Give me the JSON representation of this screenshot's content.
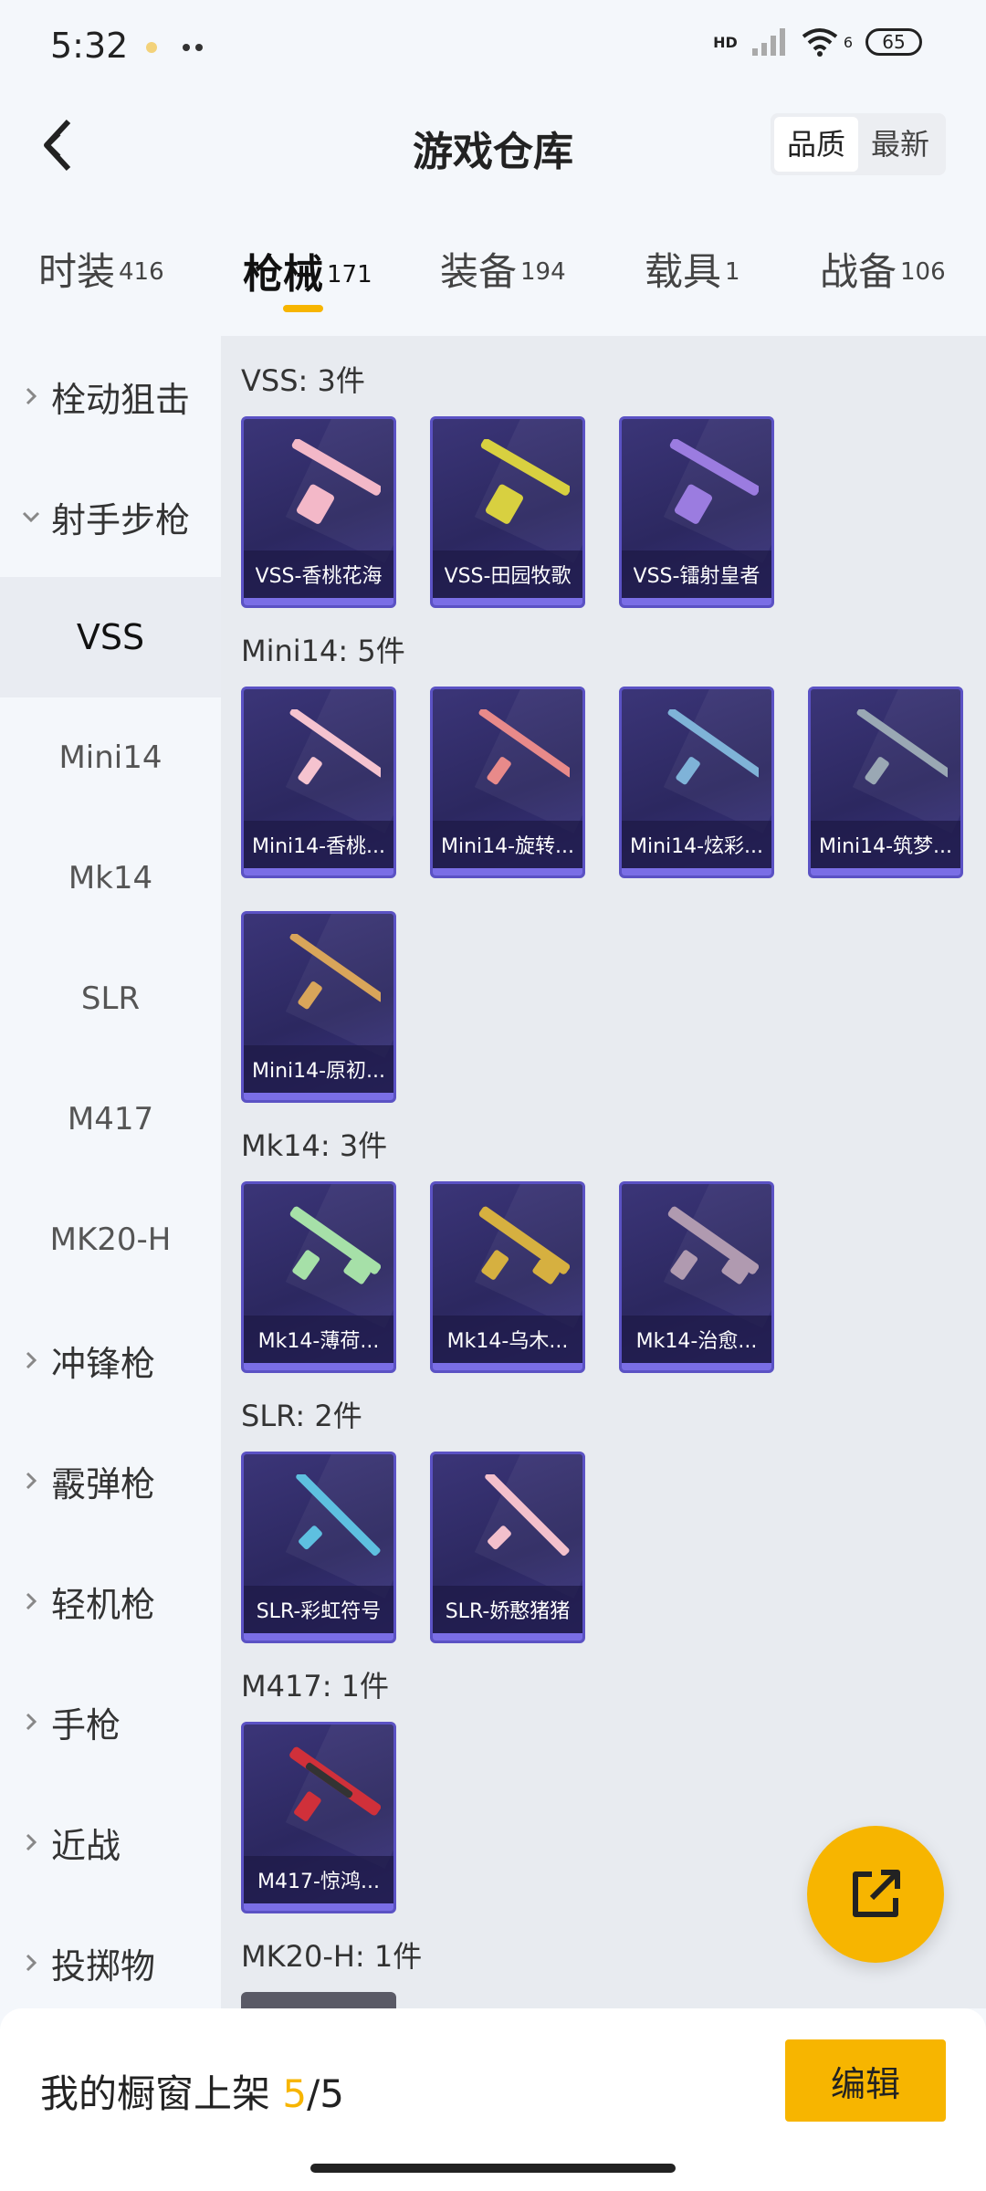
{
  "status_bar": {
    "time": "5:32",
    "battery": "65",
    "network": "HD",
    "signal_small": "6"
  },
  "header": {
    "title": "游戏仓库",
    "sort_options": [
      {
        "label": "品质",
        "active": true
      },
      {
        "label": "最新",
        "active": false
      }
    ]
  },
  "tabs": [
    {
      "label": "时装",
      "count": "416"
    },
    {
      "label": "枪械",
      "count": "171",
      "active": true
    },
    {
      "label": "装备",
      "count": "194"
    },
    {
      "label": "载具",
      "count": "1"
    },
    {
      "label": "战备",
      "count": "106"
    }
  ],
  "sidebar": {
    "items": [
      {
        "label": "栓动狙击",
        "type": "category",
        "expanded": false
      },
      {
        "label": "射手步枪",
        "type": "category",
        "expanded": true
      },
      {
        "label": "VSS",
        "type": "sub",
        "selected": true
      },
      {
        "label": "Mini14",
        "type": "sub"
      },
      {
        "label": "Mk14",
        "type": "sub"
      },
      {
        "label": "SLR",
        "type": "sub"
      },
      {
        "label": "M417",
        "type": "sub"
      },
      {
        "label": "MK20-H",
        "type": "sub"
      },
      {
        "label": "冲锋枪",
        "type": "category",
        "expanded": false
      },
      {
        "label": "霰弹枪",
        "type": "category",
        "expanded": false
      },
      {
        "label": "轻机枪",
        "type": "category",
        "expanded": false
      },
      {
        "label": "手枪",
        "type": "category",
        "expanded": false
      },
      {
        "label": "近战",
        "type": "category",
        "expanded": false
      },
      {
        "label": "投掷物",
        "type": "category",
        "expanded": false
      }
    ]
  },
  "groups": [
    {
      "title": "VSS: 3件",
      "items": [
        {
          "name": "VSS-香桃花海",
          "color": "#f3b8c8"
        },
        {
          "name": "VSS-田园牧歌",
          "color": "#d8d040"
        },
        {
          "name": "VSS-镭射皇者",
          "color": "#9b7ce0"
        }
      ]
    },
    {
      "title": "Mini14: 5件",
      "items": [
        {
          "name": "Mini14-香桃...",
          "color": "#f5c3cf"
        },
        {
          "name": "Mini14-旋转...",
          "color": "#e88a8a"
        },
        {
          "name": "Mini14-炫彩...",
          "color": "#7fb3d8"
        },
        {
          "name": "Mini14-筑梦...",
          "color": "#9aa8b4"
        },
        {
          "name": "Mini14-原初...",
          "color": "#d9a55a"
        }
      ]
    },
    {
      "title": "Mk14: 3件",
      "items": [
        {
          "name": "Mk14-薄荷...",
          "color": "#a6e0a8"
        },
        {
          "name": "Mk14-乌木...",
          "color": "#d6b040"
        },
        {
          "name": "Mk14-治愈...",
          "color": "#b09ab0"
        }
      ]
    },
    {
      "title": "SLR: 2件",
      "items": [
        {
          "name": "SLR-彩虹符号",
          "color": "#5ec0e0"
        },
        {
          "name": "SLR-娇憨猪猪",
          "color": "#f3c0cc"
        }
      ]
    },
    {
      "title": "M417: 1件",
      "items": [
        {
          "name": "M417-惊鸿...",
          "color": "#d0303a"
        }
      ]
    },
    {
      "title": "MK20-H: 1件",
      "items": []
    }
  ],
  "bottom": {
    "showcase_label": "我的橱窗上架",
    "showcase_current": "5",
    "showcase_total": "/5",
    "edit_label": "编辑"
  },
  "colors": {
    "accent": "#f7b500",
    "card_bg": "#2c2860",
    "card_border": "#5b52c4"
  }
}
